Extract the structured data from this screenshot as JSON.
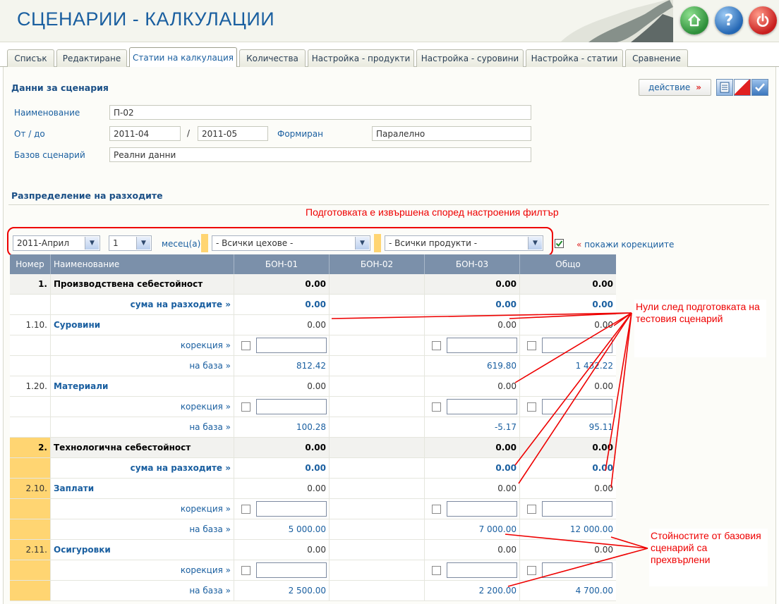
{
  "app": {
    "title": "СЦЕНАРИИ - КАЛКУЛАЦИИ"
  },
  "tabs": [
    {
      "label": "Списък"
    },
    {
      "label": "Редактиране"
    },
    {
      "label": "Статии на калкулация",
      "active": true
    },
    {
      "label": "Количества"
    },
    {
      "label": "Настройка - продукти"
    },
    {
      "label": "Настройка - суровини"
    },
    {
      "label": "Настройка - статии"
    },
    {
      "label": "Сравнение"
    }
  ],
  "scenario": {
    "section_title": "Данни за сценария",
    "action_label": "действие",
    "action_arrow": "»",
    "name_label": "Наименование",
    "name_value": "П-02",
    "period_label": "От / до",
    "from_value": "2011-04",
    "separator": "/",
    "to_value": "2011-05",
    "formed_label": "Формиран",
    "formed_value": "Паралелно",
    "base_label": "Базов сценарий",
    "base_value": "Реални данни"
  },
  "distribution": {
    "section_title": "Разпределение на разходите",
    "filter_note": "Подготовката е извършена според настроения филтър",
    "month_select": "2011-Април",
    "count_select": "1",
    "month_unit": "месец(а)",
    "dept_select": "- Всички цехове -",
    "product_select": "- Всички продукти -",
    "show_corrections_prefix": "«",
    "show_corrections": "покажи корекциите",
    "show_corrections_checked": true
  },
  "table": {
    "headers": [
      "Номер",
      "Наименование",
      "БОН-01",
      "БОН-02",
      "БОН-03",
      "Общо"
    ],
    "rows": [
      {
        "kind": "group",
        "num": "1.",
        "name": "Производствена себестойност",
        "b1": "0.00",
        "b2": "",
        "b3": "0.00",
        "tot": "0.00"
      },
      {
        "kind": "sum",
        "num": "",
        "name": "сума на разходите »",
        "b1": "0.00",
        "b2": "",
        "b3": "0.00",
        "tot": "0.00"
      },
      {
        "kind": "item",
        "num": "1.10.",
        "name": "Суровини",
        "b1": "0.00",
        "b2": "",
        "b3": "0.00",
        "tot": "0.00"
      },
      {
        "kind": "corr",
        "num": "",
        "name": "корекция »"
      },
      {
        "kind": "base",
        "num": "",
        "name": "на база »",
        "b1": "812.42",
        "b2": "",
        "b3": "619.80",
        "tot": "1 432.22"
      },
      {
        "kind": "item",
        "num": "1.20.",
        "name": "Материали",
        "b1": "0.00",
        "b2": "",
        "b3": "0.00",
        "tot": "0.00"
      },
      {
        "kind": "corr",
        "num": "",
        "name": "корекция »"
      },
      {
        "kind": "base",
        "num": "",
        "name": "на база »",
        "b1": "100.28",
        "b2": "",
        "b3": "-5.17",
        "tot": "95.11"
      },
      {
        "kind": "group",
        "num": "2.",
        "name": "Технологична себестойност",
        "b1": "0.00",
        "b2": "",
        "b3": "0.00",
        "tot": "0.00"
      },
      {
        "kind": "sum",
        "num": "",
        "name": "сума на разходите »",
        "b1": "0.00",
        "b2": "",
        "b3": "0.00",
        "tot": "0.00"
      },
      {
        "kind": "item",
        "num": "2.10.",
        "name": "Заплати",
        "b1": "0.00",
        "b2": "",
        "b3": "0.00",
        "tot": "0.00"
      },
      {
        "kind": "corr",
        "num": "",
        "name": "корекция »"
      },
      {
        "kind": "base",
        "num": "",
        "name": "на база »",
        "b1": "5 000.00",
        "b2": "",
        "b3": "7 000.00",
        "tot": "12 000.00"
      },
      {
        "kind": "item",
        "num": "2.11.",
        "name": "Осигуровки",
        "b1": "0.00",
        "b2": "",
        "b3": "0.00",
        "tot": "0.00"
      },
      {
        "kind": "corr",
        "num": "",
        "name": "корекция »"
      },
      {
        "kind": "base",
        "num": "",
        "name": "на база »",
        "b1": "2 500.00",
        "b2": "",
        "b3": "2 200.00",
        "tot": "4 700.00"
      }
    ]
  },
  "annotations": {
    "zeros_note": "Нули след подготовката на тестовия сценарий",
    "values_note": "Стойностите от базовия сценарий са прехвърлени"
  },
  "colors": {
    "accent": "#1a5fa0",
    "header_bg": "#7b90aa",
    "highlight": "#ffd572",
    "annotation": "#e00000"
  }
}
